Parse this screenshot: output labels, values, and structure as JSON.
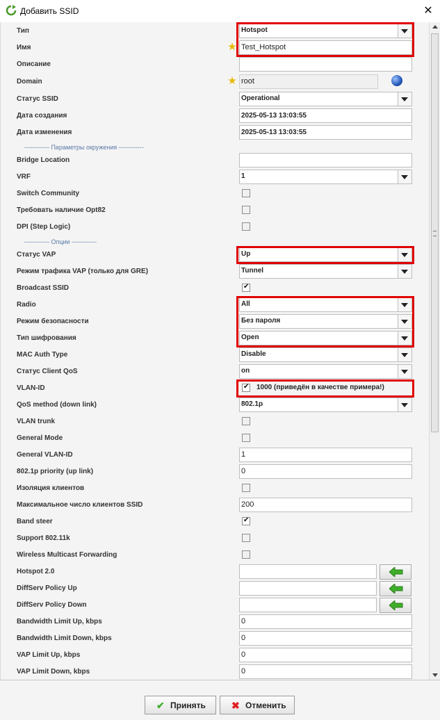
{
  "window": {
    "title": "Добавить SSID"
  },
  "sections": {
    "environment": "------------ Параметры окружения ------------",
    "options": "------------ Опции ------------"
  },
  "fields": {
    "type": {
      "label": "Тип",
      "value": "Hotspot"
    },
    "name": {
      "label": "Имя",
      "value": "Test_Hotspot"
    },
    "description": {
      "label": "Описание",
      "value": ""
    },
    "domain": {
      "label": "Domain",
      "value": "root"
    },
    "ssid_status": {
      "label": "Статус SSID",
      "value": "Operational"
    },
    "created": {
      "label": "Дата создания",
      "value": "2025-05-13 13:03:55"
    },
    "modified": {
      "label": "Дата изменения",
      "value": "2025-05-13 13:03:55"
    },
    "bridge_location": {
      "label": "Bridge Location",
      "value": ""
    },
    "vrf": {
      "label": "VRF",
      "value": "1"
    },
    "switch_community": {
      "label": "Switch Community",
      "checked": false
    },
    "opt82": {
      "label": "Требовать наличие Opt82",
      "checked": false
    },
    "dpi": {
      "label": "DPI (Step Logic)",
      "checked": false
    },
    "vap_status": {
      "label": "Статус VAP",
      "value": "Up"
    },
    "vap_traffic_mode": {
      "label": "Режим трафика VAP (только для GRE)",
      "value": "Tunnel"
    },
    "broadcast_ssid": {
      "label": "Broadcast SSID",
      "checked": true
    },
    "radio": {
      "label": "Radio",
      "value": "All"
    },
    "security_mode": {
      "label": "Режим безопасности",
      "value": "Без пароля"
    },
    "encryption_type": {
      "label": "Тип шифрования",
      "value": "Open"
    },
    "mac_auth_type": {
      "label": "MAC Auth Type",
      "value": "Disable"
    },
    "client_qos": {
      "label": "Статус Client QoS",
      "value": "on"
    },
    "vlan_id": {
      "label": "VLAN-ID",
      "checked": true,
      "value": "1000 (приведён в качестве примера!)"
    },
    "qos_method": {
      "label": "QoS method (down link)",
      "value": "802.1p"
    },
    "vlan_trunk": {
      "label": "VLAN trunk",
      "checked": false
    },
    "general_mode": {
      "label": "General Mode",
      "checked": false
    },
    "general_vlan_id": {
      "label": "General VLAN-ID",
      "value": "1"
    },
    "priority_8021p": {
      "label": "802.1p priority (up link)",
      "value": "0"
    },
    "client_isolation": {
      "label": "Изоляция клиентов",
      "checked": false
    },
    "max_clients": {
      "label": "Максимальное число клиентов SSID",
      "value": "200"
    },
    "band_steer": {
      "label": "Band steer",
      "checked": true
    },
    "support_80211k": {
      "label": "Support 802.11k",
      "checked": false
    },
    "wireless_multicast": {
      "label": "Wireless Multicast Forwarding",
      "checked": false
    },
    "hotspot20": {
      "label": "Hotspot 2.0",
      "value": ""
    },
    "diffserv_up": {
      "label": "DiffServ Policy Up",
      "value": ""
    },
    "diffserv_down": {
      "label": "DiffServ Policy Down",
      "value": ""
    },
    "bw_limit_up": {
      "label": "Bandwidth Limit Up, kbps",
      "value": "0"
    },
    "bw_limit_down": {
      "label": "Bandwidth Limit Down, kbps",
      "value": "0"
    },
    "vap_limit_up": {
      "label": "VAP Limit Up, kbps",
      "value": "0"
    },
    "vap_limit_down": {
      "label": "VAP Limit Down, kbps",
      "value": "0"
    }
  },
  "buttons": {
    "accept": "Принять",
    "cancel": "Отменить"
  },
  "colors": {
    "highlight": "#e00000",
    "section_text": "#5a7aa8",
    "accept_icon": "#3fae2a",
    "cancel_icon": "#e02020"
  }
}
